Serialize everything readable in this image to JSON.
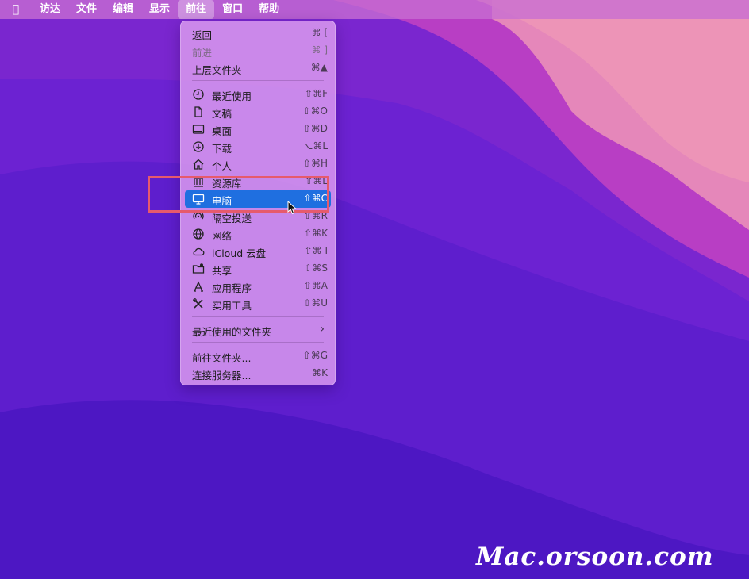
{
  "menubar": {
    "items": [
      "访达",
      "文件",
      "编辑",
      "显示",
      "前往",
      "窗口",
      "帮助"
    ],
    "active_index": 4
  },
  "go_menu": {
    "items": [
      {
        "label": "返回",
        "shortcut": "⌘ [",
        "disabled": false
      },
      {
        "label": "前进",
        "shortcut": "⌘ ]",
        "disabled": true
      },
      {
        "label": "上层文件夹",
        "shortcut": "⌘▲",
        "disabled": false
      },
      {
        "label": "最近使用",
        "shortcut": "⇧⌘F",
        "icon": "clock-icon"
      },
      {
        "label": "文稿",
        "shortcut": "⇧⌘O",
        "icon": "document-icon"
      },
      {
        "label": "桌面",
        "shortcut": "⇧⌘D",
        "icon": "desktop-icon"
      },
      {
        "label": "下载",
        "shortcut": "⌥⌘L",
        "icon": "download-icon"
      },
      {
        "label": "个人",
        "shortcut": "⇧⌘H",
        "icon": "home-icon"
      },
      {
        "label": "资源库",
        "shortcut": "⇧⌘L",
        "icon": "library-icon"
      },
      {
        "label": "电脑",
        "shortcut": "⇧⌘C",
        "icon": "computer-icon",
        "highlighted": true
      },
      {
        "label": "隔空投送",
        "shortcut": "⇧⌘R",
        "icon": "airdrop-icon"
      },
      {
        "label": "网络",
        "shortcut": "⇧⌘K",
        "icon": "network-icon"
      },
      {
        "label": "iCloud 云盘",
        "shortcut": "⇧⌘ I",
        "icon": "cloud-icon"
      },
      {
        "label": "共享",
        "shortcut": "⇧⌘S",
        "icon": "shared-folder-icon"
      },
      {
        "label": "应用程序",
        "shortcut": "⇧⌘A",
        "icon": "applications-icon"
      },
      {
        "label": "实用工具",
        "shortcut": "⇧⌘U",
        "icon": "utilities-icon"
      },
      {
        "label": "最近使用的文件夹",
        "submenu": true
      },
      {
        "label": "前往文件夹...",
        "shortcut": "⇧⌘G"
      },
      {
        "label": "连接服务器...",
        "shortcut": "⌘K"
      }
    ]
  },
  "watermark": "Mac.orsoon.com",
  "colors": {
    "highlight": "#1f6fe0",
    "annotation_box": "#e65a6c"
  }
}
